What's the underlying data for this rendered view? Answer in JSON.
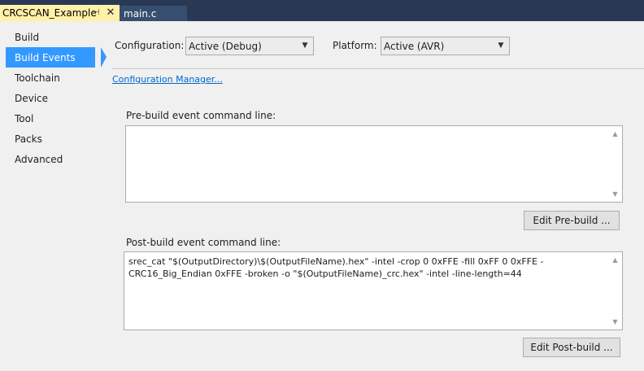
{
  "tabs": [
    {
      "label": "CRCSCAN_Example",
      "active": true,
      "pin_icon": "pin-icon",
      "close_icon": "close-icon"
    },
    {
      "label": "main.c",
      "active": false
    }
  ],
  "nav": {
    "items": [
      {
        "label": "Build",
        "selected": false
      },
      {
        "label": "Build Events",
        "selected": true
      },
      {
        "label": "Toolchain",
        "selected": false
      },
      {
        "label": "Device",
        "selected": false
      },
      {
        "label": "Tool",
        "selected": false
      },
      {
        "label": "Packs",
        "selected": false
      },
      {
        "label": "Advanced",
        "selected": false
      }
    ]
  },
  "config": {
    "configuration_label": "Configuration:",
    "configuration_value": "Active (Debug)",
    "platform_label": "Platform:",
    "platform_value": "Active (AVR)",
    "manager_link": "Configuration Manager..."
  },
  "prebuild": {
    "label": "Pre-build event command line:",
    "value": "",
    "button": "Edit Pre-build ..."
  },
  "postbuild": {
    "label": "Post-build event command line:",
    "value": "srec_cat \"$(OutputDirectory)\\$(OutputFileName).hex\" -intel -crop 0 0xFFE -fill 0xFF 0 0xFFE -CRC16_Big_Endian 0xFFE -broken -o \"$(OutputFileName)_crc.hex\" -intel -line-length=44",
    "button": "Edit Post-build ..."
  },
  "colors": {
    "tabbar": "#293955",
    "active_tab": "#fff1a8",
    "selection": "#3399ff",
    "link": "#0066cc"
  }
}
